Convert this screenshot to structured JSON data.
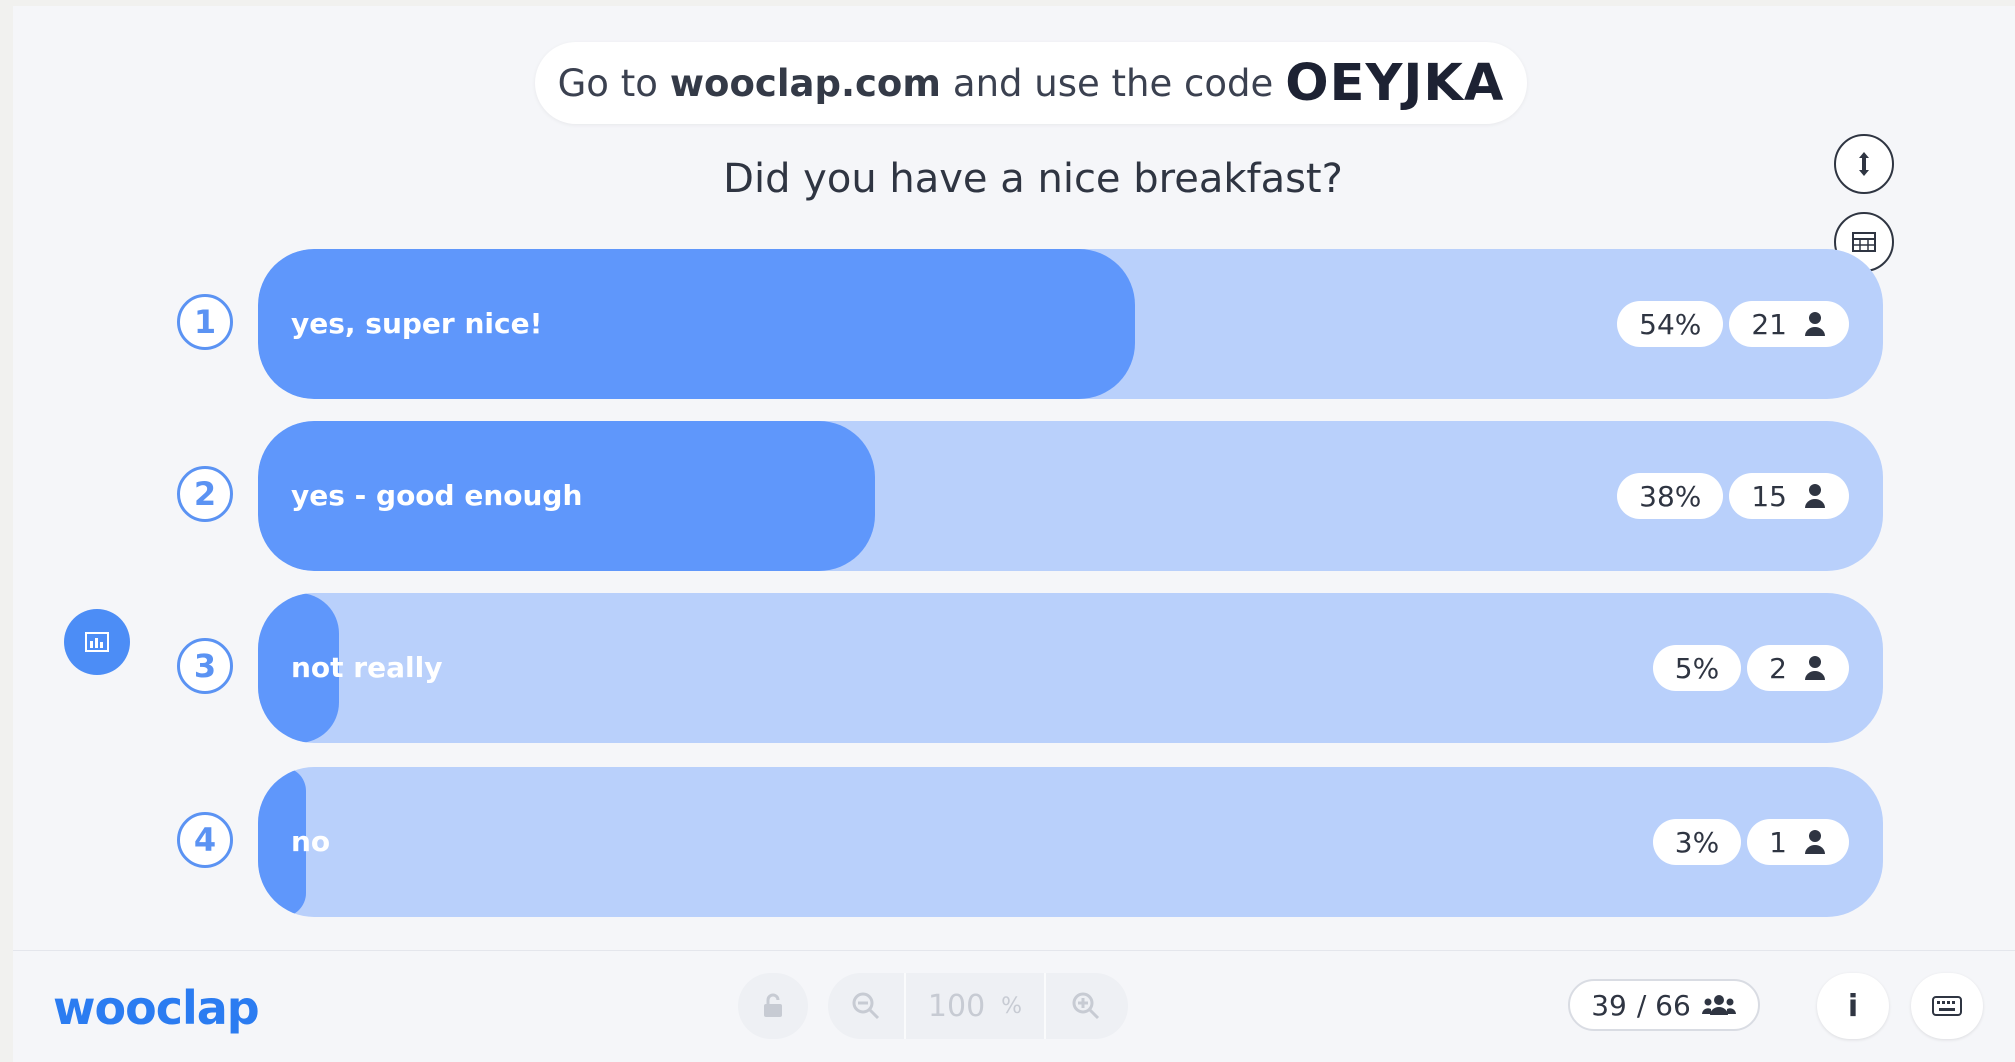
{
  "header": {
    "join_prefix": "Go to",
    "join_site": "wooclap.com",
    "join_middle": "and use the code",
    "join_code": "OEYJKA"
  },
  "question": "Did you have a nice breakfast?",
  "options": [
    {
      "number": "1",
      "label": "yes, super nice!",
      "percent": "54%",
      "count": "21",
      "fill_fraction": 0.54
    },
    {
      "number": "2",
      "label": "yes - good enough",
      "percent": "38%",
      "count": "15",
      "fill_fraction": 0.38
    },
    {
      "number": "3",
      "label": "not really",
      "percent": "5%",
      "count": "2",
      "fill_fraction": 0.05
    },
    {
      "number": "4",
      "label": "no",
      "percent": "3%",
      "count": "1",
      "fill_fraction": 0.03
    }
  ],
  "footer": {
    "logo": "wooclap",
    "zoom_value": "100",
    "zoom_unit": "%",
    "participants_current": "39",
    "participants_total": "/ 66",
    "info_label": "i"
  },
  "icons": {
    "expand": "vertical-arrows-icon",
    "layout": "layout-grid-icon",
    "chart": "bar-chart-icon",
    "person": "person-icon",
    "lock": "lock-icon",
    "zoom_out": "zoom-out-icon",
    "zoom_in": "zoom-in-icon",
    "group": "group-icon",
    "keyboard": "keyboard-icon"
  },
  "colors": {
    "accent": "#5f97fb",
    "track": "#b9d0fb",
    "logo": "#2b7cf1"
  }
}
